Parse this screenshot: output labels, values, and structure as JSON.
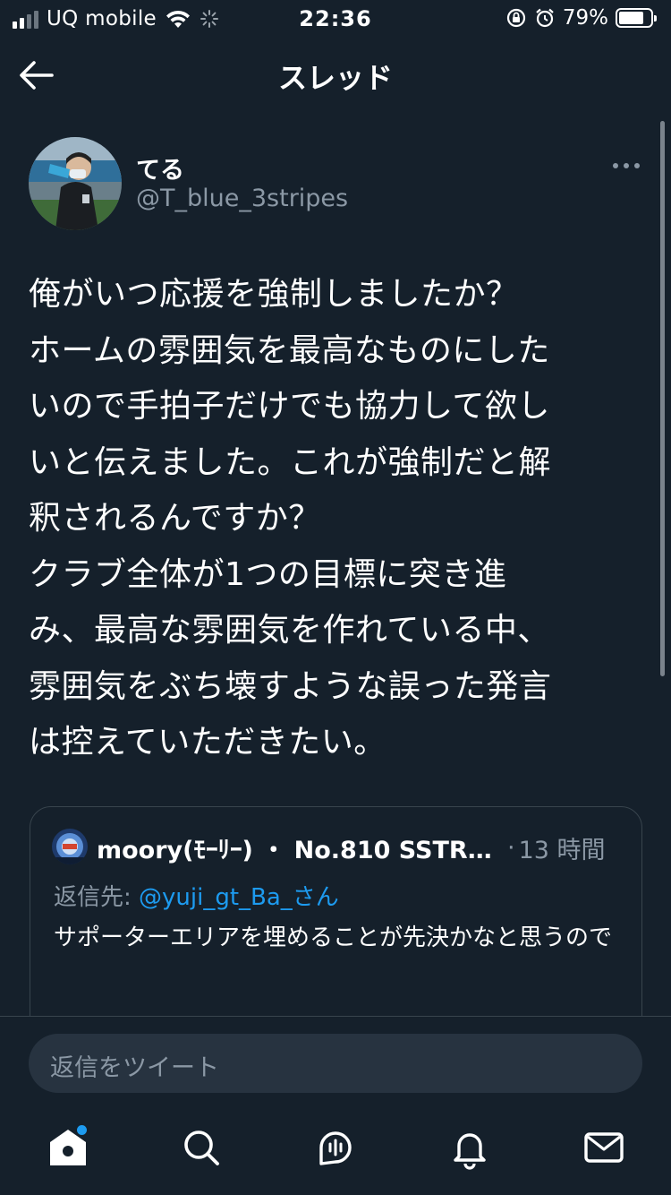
{
  "status_bar": {
    "carrier": "UQ mobile",
    "time": "22:36",
    "battery_percent": "79%",
    "battery_level": 0.79,
    "signal_bars": 2,
    "icons": [
      "signal-icon",
      "wifi-icon",
      "loading-icon",
      "rotation-lock-icon",
      "alarm-icon",
      "battery-icon"
    ]
  },
  "header": {
    "title": "スレッド",
    "back_icon": "arrow-left-icon"
  },
  "tweet": {
    "display_name": "てる",
    "handle": "@T_blue_3stripes",
    "text": "俺がいつ応援を強制しましたか？\nホームの雰囲気を最高なものにした\nいので手拍子だけでも協力して欲し\nいと伝えました。これが強制だと解\n釈されるんですか？\nクラブ全体が1つの目標に突き進\nみ、最高な雰囲気を作れている中、\n雰囲気をぶち壊すような誤った発言\nは控えていただきたい。"
  },
  "quote": {
    "name": "moory(ﾓｰﾘｰ) ・ No.810 SSTR20...",
    "separator": "·",
    "time": "13 時間",
    "reply_label": "返信先: ",
    "reply_mention": "@yuji_gt_Ba_さん",
    "text": "サポーターエリアを埋めることが先決かなと思うので"
  },
  "reply_box": {
    "placeholder": "返信をツイート"
  },
  "tabbar": {
    "items": [
      "home-icon",
      "search-icon",
      "spaces-icon",
      "notifications-icon",
      "messages-icon"
    ],
    "home_has_badge": true
  },
  "colors": {
    "background": "#15202b",
    "text_secondary": "#8b98a5",
    "accent": "#1d9bf0",
    "border": "#38444d",
    "input_bg": "#273340"
  }
}
